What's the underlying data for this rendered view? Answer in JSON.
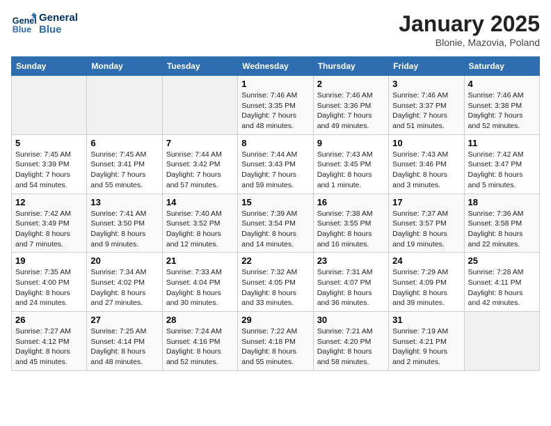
{
  "header": {
    "logo_line1": "General",
    "logo_line2": "Blue",
    "title": "January 2025",
    "subtitle": "Blonie, Mazovia, Poland"
  },
  "days_of_week": [
    "Sunday",
    "Monday",
    "Tuesday",
    "Wednesday",
    "Thursday",
    "Friday",
    "Saturday"
  ],
  "weeks": [
    [
      {
        "day": "",
        "info": ""
      },
      {
        "day": "",
        "info": ""
      },
      {
        "day": "",
        "info": ""
      },
      {
        "day": "1",
        "info": "Sunrise: 7:46 AM\nSunset: 3:35 PM\nDaylight: 7 hours and 48 minutes."
      },
      {
        "day": "2",
        "info": "Sunrise: 7:46 AM\nSunset: 3:36 PM\nDaylight: 7 hours and 49 minutes."
      },
      {
        "day": "3",
        "info": "Sunrise: 7:46 AM\nSunset: 3:37 PM\nDaylight: 7 hours and 51 minutes."
      },
      {
        "day": "4",
        "info": "Sunrise: 7:46 AM\nSunset: 3:38 PM\nDaylight: 7 hours and 52 minutes."
      }
    ],
    [
      {
        "day": "5",
        "info": "Sunrise: 7:45 AM\nSunset: 3:39 PM\nDaylight: 7 hours and 54 minutes."
      },
      {
        "day": "6",
        "info": "Sunrise: 7:45 AM\nSunset: 3:41 PM\nDaylight: 7 hours and 55 minutes."
      },
      {
        "day": "7",
        "info": "Sunrise: 7:44 AM\nSunset: 3:42 PM\nDaylight: 7 hours and 57 minutes."
      },
      {
        "day": "8",
        "info": "Sunrise: 7:44 AM\nSunset: 3:43 PM\nDaylight: 7 hours and 59 minutes."
      },
      {
        "day": "9",
        "info": "Sunrise: 7:43 AM\nSunset: 3:45 PM\nDaylight: 8 hours and 1 minute."
      },
      {
        "day": "10",
        "info": "Sunrise: 7:43 AM\nSunset: 3:46 PM\nDaylight: 8 hours and 3 minutes."
      },
      {
        "day": "11",
        "info": "Sunrise: 7:42 AM\nSunset: 3:47 PM\nDaylight: 8 hours and 5 minutes."
      }
    ],
    [
      {
        "day": "12",
        "info": "Sunrise: 7:42 AM\nSunset: 3:49 PM\nDaylight: 8 hours and 7 minutes."
      },
      {
        "day": "13",
        "info": "Sunrise: 7:41 AM\nSunset: 3:50 PM\nDaylight: 8 hours and 9 minutes."
      },
      {
        "day": "14",
        "info": "Sunrise: 7:40 AM\nSunset: 3:52 PM\nDaylight: 8 hours and 12 minutes."
      },
      {
        "day": "15",
        "info": "Sunrise: 7:39 AM\nSunset: 3:54 PM\nDaylight: 8 hours and 14 minutes."
      },
      {
        "day": "16",
        "info": "Sunrise: 7:38 AM\nSunset: 3:55 PM\nDaylight: 8 hours and 16 minutes."
      },
      {
        "day": "17",
        "info": "Sunrise: 7:37 AM\nSunset: 3:57 PM\nDaylight: 8 hours and 19 minutes."
      },
      {
        "day": "18",
        "info": "Sunrise: 7:36 AM\nSunset: 3:58 PM\nDaylight: 8 hours and 22 minutes."
      }
    ],
    [
      {
        "day": "19",
        "info": "Sunrise: 7:35 AM\nSunset: 4:00 PM\nDaylight: 8 hours and 24 minutes."
      },
      {
        "day": "20",
        "info": "Sunrise: 7:34 AM\nSunset: 4:02 PM\nDaylight: 8 hours and 27 minutes."
      },
      {
        "day": "21",
        "info": "Sunrise: 7:33 AM\nSunset: 4:04 PM\nDaylight: 8 hours and 30 minutes."
      },
      {
        "day": "22",
        "info": "Sunrise: 7:32 AM\nSunset: 4:05 PM\nDaylight: 8 hours and 33 minutes."
      },
      {
        "day": "23",
        "info": "Sunrise: 7:31 AM\nSunset: 4:07 PM\nDaylight: 8 hours and 36 minutes."
      },
      {
        "day": "24",
        "info": "Sunrise: 7:29 AM\nSunset: 4:09 PM\nDaylight: 8 hours and 39 minutes."
      },
      {
        "day": "25",
        "info": "Sunrise: 7:28 AM\nSunset: 4:11 PM\nDaylight: 8 hours and 42 minutes."
      }
    ],
    [
      {
        "day": "26",
        "info": "Sunrise: 7:27 AM\nSunset: 4:12 PM\nDaylight: 8 hours and 45 minutes."
      },
      {
        "day": "27",
        "info": "Sunrise: 7:25 AM\nSunset: 4:14 PM\nDaylight: 8 hours and 48 minutes."
      },
      {
        "day": "28",
        "info": "Sunrise: 7:24 AM\nSunset: 4:16 PM\nDaylight: 8 hours and 52 minutes."
      },
      {
        "day": "29",
        "info": "Sunrise: 7:22 AM\nSunset: 4:18 PM\nDaylight: 8 hours and 55 minutes."
      },
      {
        "day": "30",
        "info": "Sunrise: 7:21 AM\nSunset: 4:20 PM\nDaylight: 8 hours and 58 minutes."
      },
      {
        "day": "31",
        "info": "Sunrise: 7:19 AM\nSunset: 4:21 PM\nDaylight: 9 hours and 2 minutes."
      },
      {
        "day": "",
        "info": ""
      }
    ]
  ]
}
